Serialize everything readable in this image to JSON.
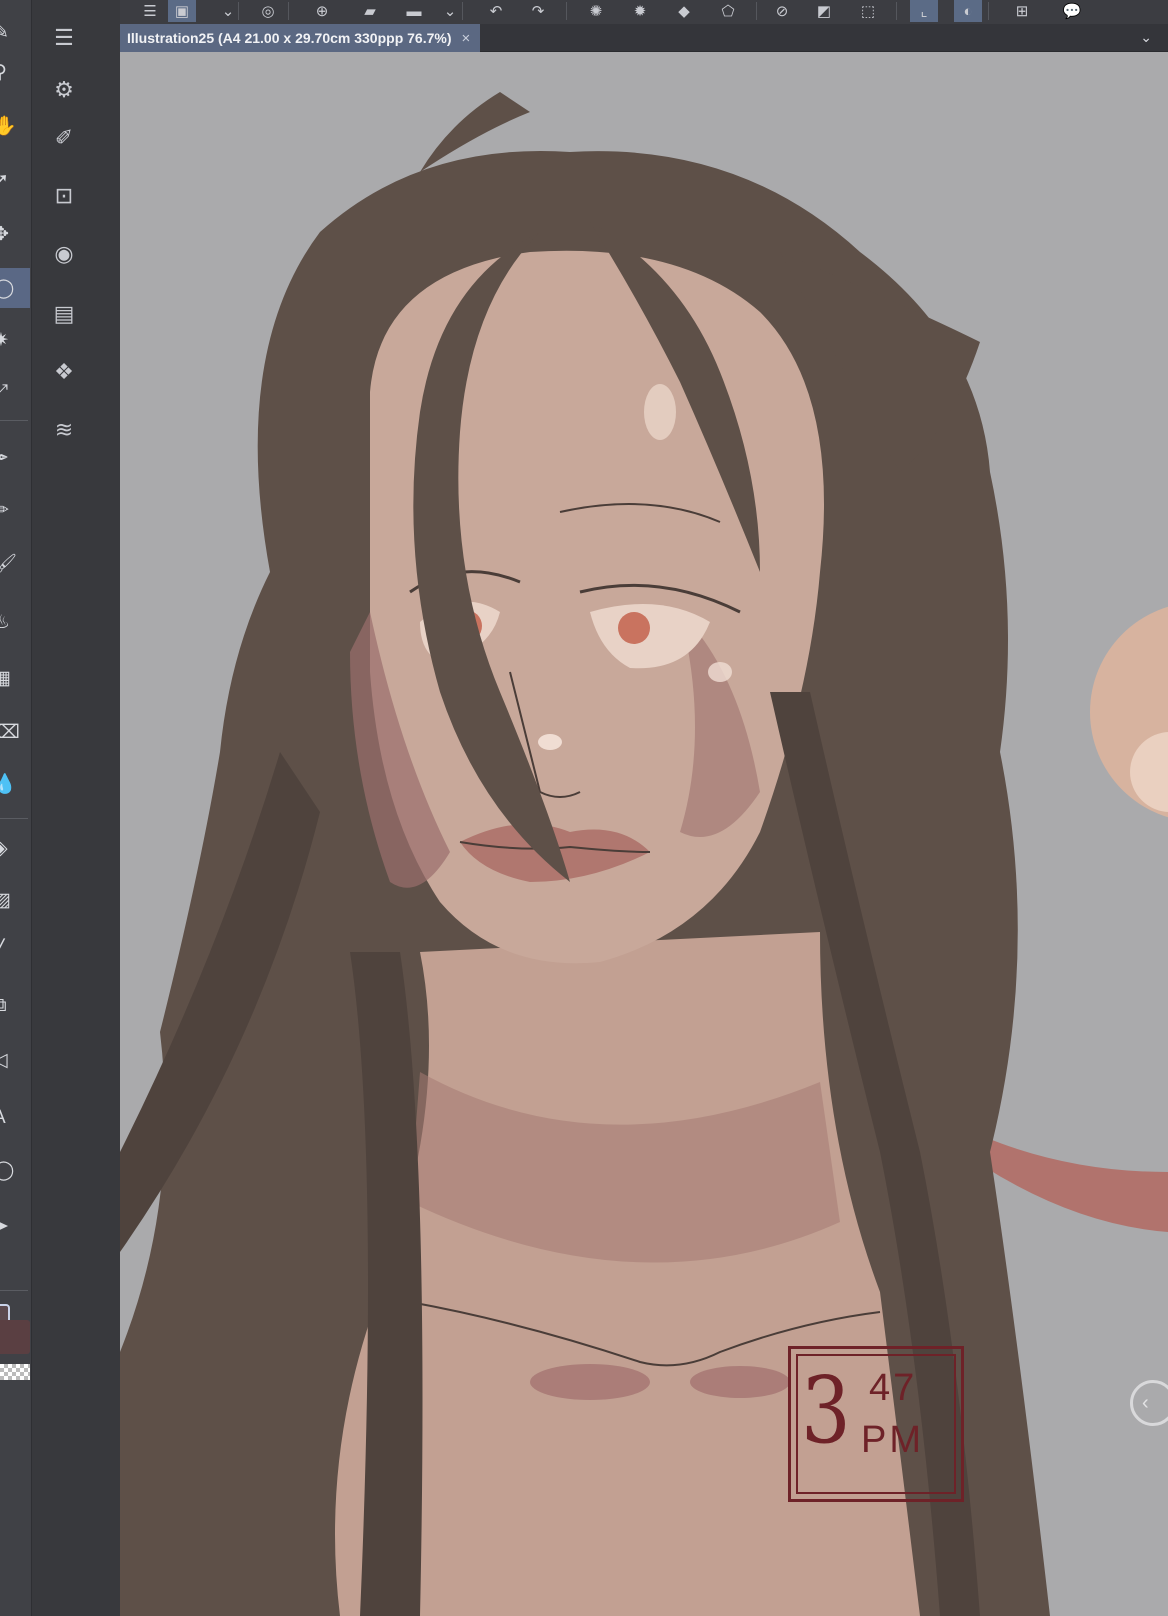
{
  "document": {
    "tab_title": "Illustration25 (A4 21.00 x 29.70cm 330ppp 76.7%)",
    "close_glyph": "×",
    "tab_menu_glyph": "⌄"
  },
  "command_bar": {
    "items": [
      {
        "name": "menu-icon",
        "glyph": "☰"
      },
      {
        "name": "new-layer-icon",
        "glyph": "▣",
        "active": true
      },
      {
        "name": "dropdown-icon",
        "glyph": "⌄"
      },
      {
        "name": "layer-mask-icon",
        "glyph": "◎"
      },
      {
        "name": "add-icon",
        "glyph": "⊕"
      },
      {
        "name": "folder-icon",
        "glyph": "▰"
      },
      {
        "name": "fill-icon",
        "glyph": "▬"
      },
      {
        "name": "dropdown-icon-2",
        "glyph": "⌄"
      },
      {
        "name": "undo-icon",
        "glyph": "↶"
      },
      {
        "name": "redo-icon",
        "glyph": "↷"
      },
      {
        "name": "deselect-icon",
        "glyph": "✺"
      },
      {
        "name": "select-all-icon",
        "glyph": "✹"
      },
      {
        "name": "fill-selection-icon",
        "glyph": "◆"
      },
      {
        "name": "transform-icon",
        "glyph": "⬠"
      },
      {
        "name": "clear-icon",
        "glyph": "⊘"
      },
      {
        "name": "tone-icon",
        "glyph": "◩"
      },
      {
        "name": "crop-icon",
        "glyph": "⬚"
      },
      {
        "name": "ruler-snap-icon",
        "glyph": "⌞",
        "active": true
      },
      {
        "name": "special-ruler-icon",
        "glyph": "◐",
        "active": true
      },
      {
        "name": "grid-snap-icon",
        "glyph": "⊞"
      },
      {
        "name": "help-icon",
        "glyph": "💬"
      }
    ]
  },
  "tools": [
    {
      "name": "pen-tool-icon",
      "glyph": "✎"
    },
    {
      "name": "zoom-tool-icon",
      "glyph": "⚲"
    },
    {
      "name": "hand-tool-icon",
      "glyph": "✋"
    },
    {
      "name": "operation-tool-icon",
      "glyph": "➚"
    },
    {
      "name": "move-layer-tool-icon",
      "glyph": "✥"
    },
    {
      "name": "lasso-select-tool-icon",
      "glyph": "◯",
      "active": true
    },
    {
      "name": "auto-select-tool-icon",
      "glyph": "✷"
    },
    {
      "name": "eyedropper-tool-icon",
      "glyph": "⤢"
    },
    {
      "name": "pen-icon",
      "glyph": "✒"
    },
    {
      "name": "pencil-icon",
      "glyph": "✏"
    },
    {
      "name": "brush-icon",
      "glyph": "🖌"
    },
    {
      "name": "airbrush-icon",
      "glyph": "♨"
    },
    {
      "name": "decoration-icon",
      "glyph": "▦"
    },
    {
      "name": "eraser-icon",
      "glyph": "⌫"
    },
    {
      "name": "blend-icon",
      "glyph": "💧"
    },
    {
      "name": "fill-tool-icon",
      "glyph": "◈"
    },
    {
      "name": "gradient-tool-icon",
      "glyph": "▨"
    },
    {
      "name": "figure-tool-icon",
      "glyph": "╱"
    },
    {
      "name": "frame-tool-icon",
      "glyph": "⧉"
    },
    {
      "name": "ruler-tool-icon",
      "glyph": "◁"
    },
    {
      "name": "text-tool-icon",
      "glyph": "A"
    },
    {
      "name": "balloon-tool-icon",
      "glyph": "◯"
    },
    {
      "name": "correct-line-tool-icon",
      "glyph": "➤"
    }
  ],
  "palettes": [
    {
      "name": "sub-tool-palette-icon",
      "glyph": "☰"
    },
    {
      "name": "tool-property-icon",
      "glyph": "⚙"
    },
    {
      "name": "brush-size-icon",
      "glyph": "✐"
    },
    {
      "name": "navigator-icon",
      "glyph": "⊡"
    },
    {
      "name": "color-wheel-icon",
      "glyph": "◉"
    },
    {
      "name": "animation-icon",
      "glyph": "▤"
    },
    {
      "name": "layer-property-icon",
      "glyph": "❖"
    },
    {
      "name": "layer-palette-icon",
      "glyph": "≋"
    }
  ],
  "timestamp": {
    "hour": "3",
    "minute": "47",
    "ampm": "PM"
  },
  "colors": {
    "background": "#aaaaac",
    "hair": "#5e5048",
    "skin": "#c8a89a",
    "shadow": "#9a6e6c",
    "stamp": "#6e2228",
    "active_tool": "#5a6885"
  },
  "side_handle_glyph": "‹"
}
